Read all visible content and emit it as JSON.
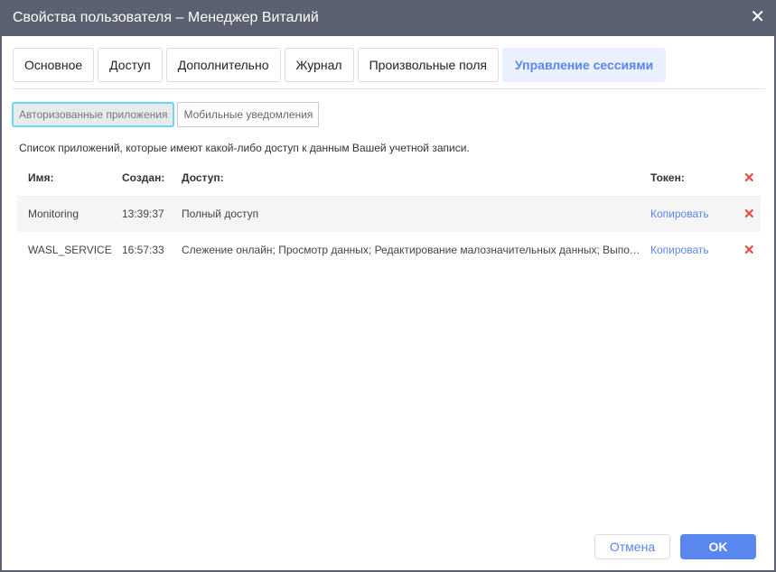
{
  "title": "Свойства пользователя – Менеджер Виталий",
  "tabs": [
    "Основное",
    "Доступ",
    "Дополнительно",
    "Журнал",
    "Произвольные поля",
    "Управление сессиями"
  ],
  "subtabs": [
    "Авторизованные приложения",
    "Мобильные уведомления"
  ],
  "description": "Список приложений, которые имеют какой-либо доступ к данным Вашей учетной записи.",
  "table": {
    "headers": {
      "name": "Имя:",
      "created": "Создан:",
      "access": "Доступ:",
      "token": "Токен:"
    },
    "rows": [
      {
        "name": "Monitoring",
        "created": "13:39:37",
        "access": "Полный доступ",
        "token": "Копировать"
      },
      {
        "name": "WASL_SERVICE",
        "created": "16:57:33",
        "access": "Слежение онлайн; Просмотр данных; Редактирование малозначительных данных; Выполнение команд",
        "token": "Копировать"
      }
    ]
  },
  "buttons": {
    "cancel": "Отмена",
    "ok": "OK"
  }
}
